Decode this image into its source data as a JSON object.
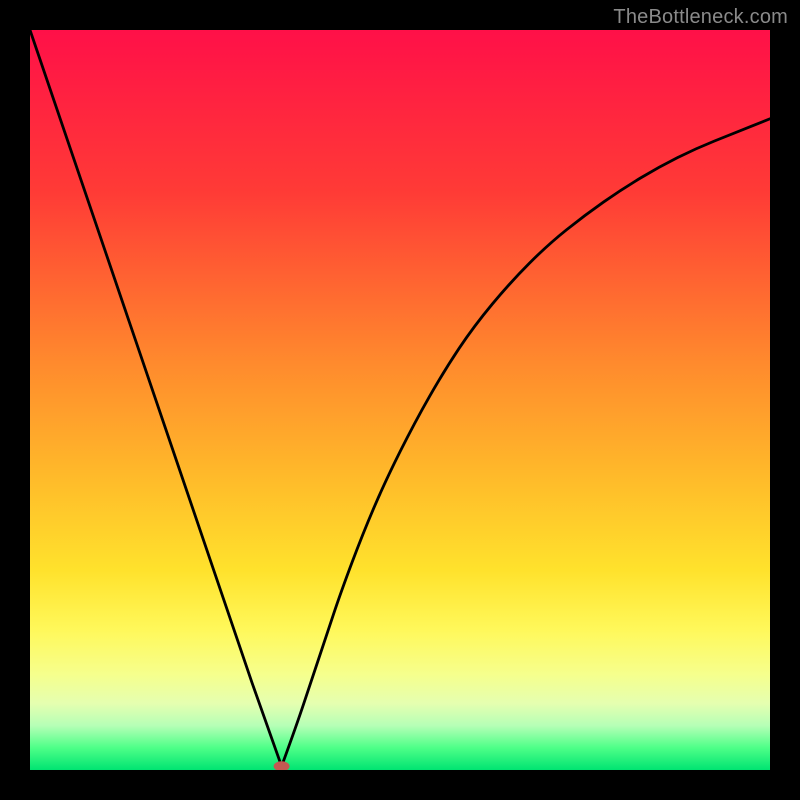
{
  "watermark": "TheBottleneck.com",
  "chart_data": {
    "type": "line",
    "title": "",
    "xlabel": "",
    "ylabel": "",
    "xlim": [
      0,
      100
    ],
    "ylim": [
      0,
      100
    ],
    "background_gradient_stops": [
      {
        "offset": 0,
        "color": "#ff1048"
      },
      {
        "offset": 22,
        "color": "#ff3b36"
      },
      {
        "offset": 45,
        "color": "#ff8a2d"
      },
      {
        "offset": 60,
        "color": "#ffb92a"
      },
      {
        "offset": 73,
        "color": "#ffe22c"
      },
      {
        "offset": 81,
        "color": "#fff85a"
      },
      {
        "offset": 87,
        "color": "#f6ff8c"
      },
      {
        "offset": 91,
        "color": "#e5ffb0"
      },
      {
        "offset": 94,
        "color": "#b6ffb6"
      },
      {
        "offset": 97,
        "color": "#4eff88"
      },
      {
        "offset": 100,
        "color": "#00e472"
      }
    ],
    "series": [
      {
        "name": "left-branch",
        "x": [
          0,
          5,
          10,
          15,
          20,
          25,
          30,
          34
        ],
        "values": [
          100,
          85.3,
          70.6,
          55.9,
          41.2,
          26.5,
          11.8,
          0.5
        ]
      },
      {
        "name": "right-branch",
        "x": [
          34,
          36,
          38,
          40,
          42,
          45,
          48,
          52,
          56,
          60,
          65,
          70,
          75,
          80,
          85,
          90,
          95,
          100
        ],
        "values": [
          0.5,
          6,
          12,
          18,
          24,
          32,
          39,
          47,
          54,
          60,
          66,
          71,
          75,
          78.5,
          81.5,
          84,
          86,
          88
        ]
      }
    ],
    "marker": {
      "x": 34,
      "y": 0.5,
      "color": "#c45a52",
      "rx": 8,
      "ry": 5
    }
  }
}
